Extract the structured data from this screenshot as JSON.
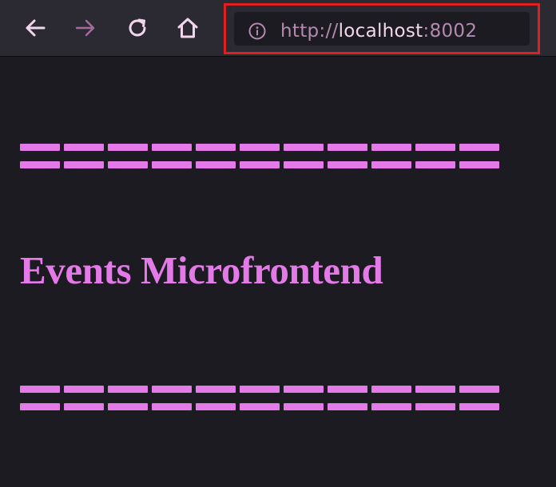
{
  "browser": {
    "url_scheme": "http://",
    "url_host": "localhost",
    "url_port": ":8002",
    "back_icon": "arrow-left-icon",
    "forward_icon": "arrow-right-icon",
    "reload_icon": "reload-icon",
    "home_icon": "home-icon",
    "site_info_icon": "info-icon",
    "highlight_color": "#e02020"
  },
  "page": {
    "divider_top": "===========",
    "heading": "Events Microfrontend",
    "divider_bottom": "===========",
    "text_color": "#e47ae8",
    "background_color": "#1c1b22"
  }
}
